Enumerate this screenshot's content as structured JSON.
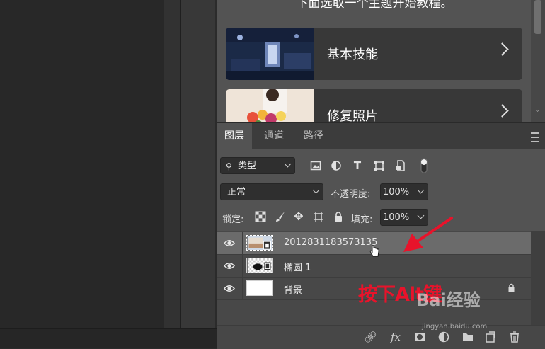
{
  "learn_panel": {
    "heading": "下面选取一个主题开始教程。",
    "tutorials": [
      {
        "label": "基本技能"
      },
      {
        "label": "修复照片"
      }
    ]
  },
  "layers_panel": {
    "tabs": [
      {
        "label": "图层",
        "active": true
      },
      {
        "label": "通道",
        "active": false
      },
      {
        "label": "路径",
        "active": false
      }
    ],
    "filter": {
      "kind_label": "类型"
    },
    "blend_mode": "正常",
    "opacity": {
      "label": "不透明度:",
      "value": "100%"
    },
    "lock": {
      "label": "锁定:"
    },
    "fill": {
      "label": "填充:",
      "value": "100%"
    },
    "layers": [
      {
        "name": "2012831183573135",
        "selected": true,
        "locked": false
      },
      {
        "name": "椭圆 1",
        "selected": false,
        "locked": false
      },
      {
        "name": "背景",
        "selected": false,
        "locked": true
      }
    ],
    "bottom_icons": [
      "link-icon",
      "fx-icon",
      "mask-icon",
      "adjustment-icon",
      "folder-icon",
      "new-layer-icon",
      "trash-icon"
    ],
    "fx_label": "fx"
  },
  "annotation": {
    "text": "按下Alt键",
    "color": "#e8132b"
  },
  "watermark": {
    "brand": "Bai经验",
    "url": "jingyan.baidu.com"
  },
  "colors": {
    "panel_bg": "#535353",
    "tab_bar_bg": "#3c3c3c",
    "selected_row": "#6b6b6b",
    "field_bg": "#2f2f2f",
    "annotation_red": "#e8132b"
  }
}
